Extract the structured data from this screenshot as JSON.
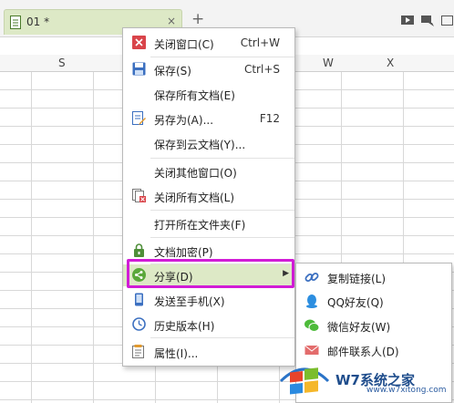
{
  "tab": {
    "title": "01 *",
    "close": "×"
  },
  "new_tab": "+",
  "columns": [
    "S",
    "W",
    "X"
  ],
  "menu": {
    "items": [
      {
        "label": "关闭窗口(C)",
        "shortcut": "Ctrl+W",
        "icon": "close-window-icon"
      },
      {
        "label": "保存(S)",
        "shortcut": "Ctrl+S",
        "icon": "save-icon"
      },
      {
        "label": "保存所有文档(E)",
        "shortcut": "",
        "icon": ""
      },
      {
        "label": "另存为(A)...",
        "shortcut": "F12",
        "icon": "save-as-icon"
      },
      {
        "label": "保存到云文档(Y)...",
        "shortcut": "",
        "icon": ""
      },
      {
        "label": "关闭其他窗口(O)",
        "shortcut": "",
        "icon": ""
      },
      {
        "label": "关闭所有文档(L)",
        "shortcut": "",
        "icon": "close-all-icon"
      },
      {
        "label": "打开所在文件夹(F)",
        "shortcut": "",
        "icon": ""
      },
      {
        "label": "文档加密(P)",
        "shortcut": "",
        "icon": "lock-icon"
      },
      {
        "label": "分享(D)",
        "shortcut": "",
        "icon": "share-icon"
      },
      {
        "label": "发送至手机(X)",
        "shortcut": "",
        "icon": "phone-icon"
      },
      {
        "label": "历史版本(H)",
        "shortcut": "",
        "icon": "history-icon"
      },
      {
        "label": "属性(I)...",
        "shortcut": "",
        "icon": "properties-icon"
      }
    ]
  },
  "submenu": {
    "items": [
      {
        "label": "复制链接(L)",
        "icon": "link-icon"
      },
      {
        "label": "QQ好友(Q)",
        "icon": "qq-icon"
      },
      {
        "label": "微信好友(W)",
        "icon": "wechat-icon"
      },
      {
        "label": "邮件联系人(D)",
        "icon": "mail-icon"
      }
    ]
  },
  "watermark": {
    "brand": "W7系统之家",
    "url": "www.w7xitong.com"
  },
  "colors": {
    "highlight_border": "#d11cd6",
    "active_bg": "#dde9c6",
    "share_green": "#5aa83a"
  }
}
